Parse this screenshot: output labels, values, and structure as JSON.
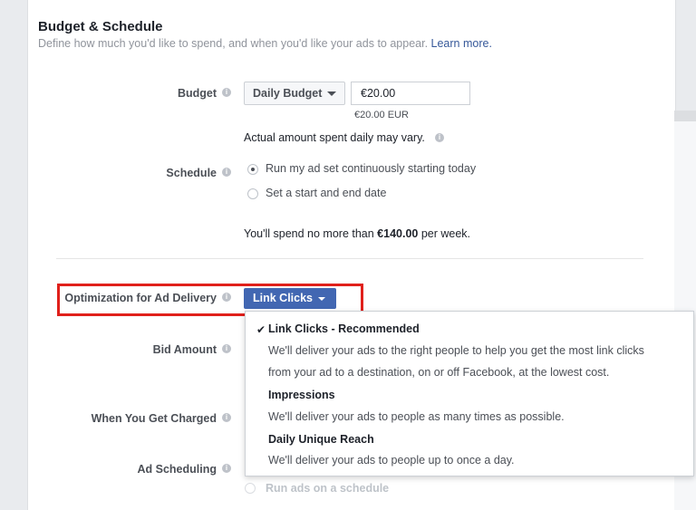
{
  "section": {
    "title": "Budget & Schedule",
    "subtitle": "Define how much you'd like to spend, and when you'd like your ads to appear.",
    "learn_more": "Learn more."
  },
  "budget": {
    "label": "Budget",
    "type_selected": "Daily Budget",
    "amount": "€20.00",
    "amount_note": "€20.00 EUR",
    "vary_note": "Actual amount spent daily may vary."
  },
  "schedule": {
    "label": "Schedule",
    "options": [
      {
        "label": "Run my ad set continuously starting today",
        "selected": true
      },
      {
        "label": "Set a start and end date",
        "selected": false
      }
    ],
    "spend_prefix": "You'll spend no more than ",
    "spend_amount": "€140.00",
    "spend_suffix": " per week."
  },
  "optimization": {
    "label": "Optimization for Ad Delivery",
    "selected": "Link Clicks",
    "highlight_color": "#e0201b",
    "button_color": "#4267b2",
    "menu": [
      {
        "title": "Link Clicks - Recommended",
        "checked": true,
        "desc": [
          "We'll deliver your ads to the right people to help you get the most link clicks",
          "from your ad to a destination, on or off Facebook, at the lowest cost."
        ]
      },
      {
        "title": "Impressions",
        "checked": false,
        "desc": [
          "We'll deliver your ads to people as many times as possible."
        ]
      },
      {
        "title": "Daily Unique Reach",
        "checked": false,
        "desc": [
          "We'll deliver your ads to people up to once a day."
        ]
      }
    ]
  },
  "bid_amount": {
    "label": "Bid Amount"
  },
  "when_charged": {
    "label": "When You Get Charged"
  },
  "ad_scheduling": {
    "label": "Ad Scheduling",
    "option_schedule": "Run ads on a schedule"
  },
  "icons": {
    "info": "info-icon",
    "check": "checkmark-icon",
    "caret": "caret-down-icon"
  }
}
